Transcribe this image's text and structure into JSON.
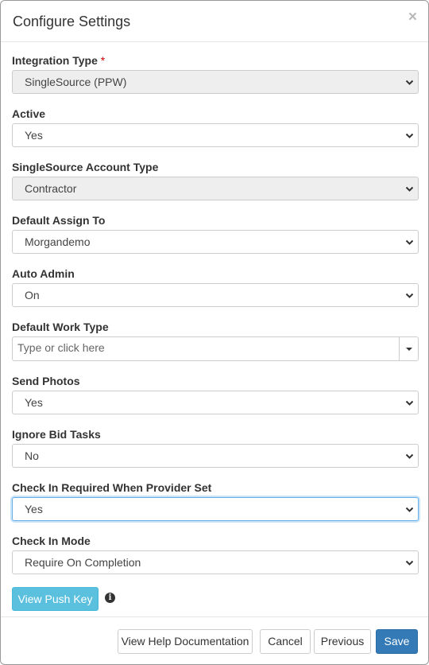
{
  "dialog": {
    "title": "Configure Settings",
    "close_symbol": "×",
    "required_marker": "*"
  },
  "fields": {
    "integration_type": {
      "label": "Integration Type",
      "value": "SingleSource (PPW)",
      "required": true,
      "disabled": true
    },
    "active": {
      "label": "Active",
      "value": "Yes"
    },
    "account_type": {
      "label": "SingleSource Account Type",
      "value": "Contractor",
      "disabled": true
    },
    "default_assign_to": {
      "label": "Default Assign To",
      "value": "Morgandemo"
    },
    "auto_admin": {
      "label": "Auto Admin",
      "value": "On"
    },
    "default_work_type": {
      "label": "Default Work Type",
      "placeholder": "Type or click here"
    },
    "send_photos": {
      "label": "Send Photos",
      "value": "Yes"
    },
    "ignore_bid_tasks": {
      "label": "Ignore Bid Tasks",
      "value": "No"
    },
    "check_in_required": {
      "label": "Check In Required When Provider Set",
      "value": "Yes",
      "focused": true
    },
    "check_in_mode": {
      "label": "Check In Mode",
      "value": "Require On Completion"
    }
  },
  "push_key": {
    "button_label": "View Push Key",
    "info_icon": "info-circle-icon",
    "info_symbol": "i"
  },
  "footer": {
    "help_label": "View Help Documentation",
    "cancel_label": "Cancel",
    "previous_label": "Previous",
    "save_label": "Save"
  },
  "colors": {
    "info_button": "#5bc0de",
    "primary_button": "#337ab7",
    "focus_border": "#66afe9",
    "required": "#cc0000",
    "disabled_bg": "#eeeeee"
  }
}
